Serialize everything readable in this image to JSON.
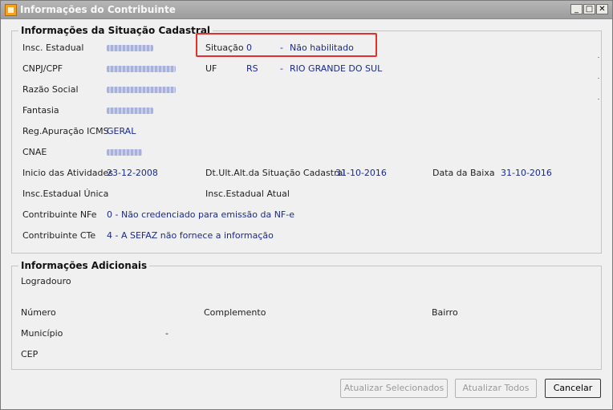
{
  "window": {
    "title": "Informações do Contribuinte",
    "controls": {
      "minimize": "_",
      "maximize": "□",
      "close": "✕"
    }
  },
  "situacao_cadastral": {
    "legend": "Informações da Situação Cadastral",
    "insc_estadual": {
      "label": "Insc. Estadual"
    },
    "cnpj_cpf": {
      "label": "CNPJ/CPF"
    },
    "razao_social": {
      "label": "Razão Social"
    },
    "fantasia": {
      "label": "Fantasia"
    },
    "reg_apuracao": {
      "label": "Reg.Apuração ICMS",
      "value": "GERAL"
    },
    "cnae": {
      "label": "CNAE"
    },
    "situacao": {
      "label": "Situação",
      "code": "0",
      "sep": "-",
      "desc": "Não habilitado"
    },
    "uf": {
      "label": "UF",
      "code": "RS",
      "sep": "-",
      "desc": "RIO GRANDE DO SUL"
    },
    "inicio_atividades": {
      "label": "Inicio das Atividades",
      "value": "23-12-2008"
    },
    "dt_ult_alt": {
      "label": "Dt.Ult.Alt.da Situação Cadastral",
      "value": "31-10-2016"
    },
    "data_baixa": {
      "label": "Data da Baixa",
      "value": "31-10-2016"
    },
    "insc_estadual_unica": {
      "label": "Insc.Estadual Única"
    },
    "insc_estadual_atual": {
      "label": "Insc.Estadual Atual"
    },
    "contribuinte_nfe": {
      "label": "Contribuinte NFe",
      "value": "0 - Não credenciado para emissão da NF-e"
    },
    "contribuinte_cte": {
      "label": "Contribuinte CTe",
      "value": "4 - A SEFAZ não fornece a informação"
    }
  },
  "adicionais": {
    "legend": "Informações Adicionais",
    "logradouro": {
      "label": "Logradouro"
    },
    "numero": {
      "label": "Número"
    },
    "complemento": {
      "label": "Complemento"
    },
    "bairro": {
      "label": "Bairro"
    },
    "municipio": {
      "label": "Município",
      "value": "-"
    },
    "cep": {
      "label": "CEP"
    }
  },
  "buttons": {
    "atualizar_selecionados": "Atualizar Selecionados",
    "atualizar_todos": "Atualizar Todos",
    "cancelar": "Cancelar"
  },
  "colors": {
    "value_text": "#1b2a8f",
    "highlight": "#e03030"
  }
}
